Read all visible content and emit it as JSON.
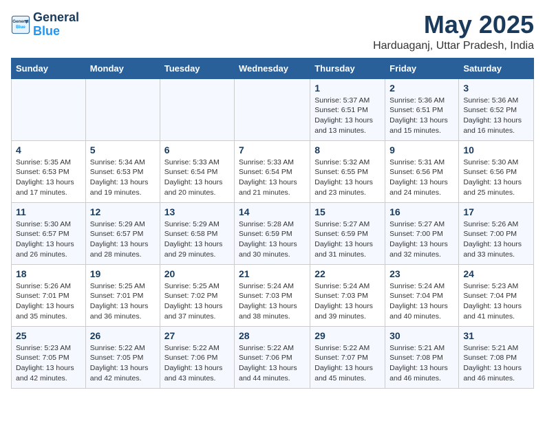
{
  "header": {
    "logo_line1": "General",
    "logo_line2": "Blue",
    "month_year": "May 2025",
    "location": "Harduaganj, Uttar Pradesh, India"
  },
  "days_of_week": [
    "Sunday",
    "Monday",
    "Tuesday",
    "Wednesday",
    "Thursday",
    "Friday",
    "Saturday"
  ],
  "weeks": [
    [
      {
        "day": "",
        "info": ""
      },
      {
        "day": "",
        "info": ""
      },
      {
        "day": "",
        "info": ""
      },
      {
        "day": "",
        "info": ""
      },
      {
        "day": "1",
        "info": "Sunrise: 5:37 AM\nSunset: 6:51 PM\nDaylight: 13 hours\nand 13 minutes."
      },
      {
        "day": "2",
        "info": "Sunrise: 5:36 AM\nSunset: 6:51 PM\nDaylight: 13 hours\nand 15 minutes."
      },
      {
        "day": "3",
        "info": "Sunrise: 5:36 AM\nSunset: 6:52 PM\nDaylight: 13 hours\nand 16 minutes."
      }
    ],
    [
      {
        "day": "4",
        "info": "Sunrise: 5:35 AM\nSunset: 6:53 PM\nDaylight: 13 hours\nand 17 minutes."
      },
      {
        "day": "5",
        "info": "Sunrise: 5:34 AM\nSunset: 6:53 PM\nDaylight: 13 hours\nand 19 minutes."
      },
      {
        "day": "6",
        "info": "Sunrise: 5:33 AM\nSunset: 6:54 PM\nDaylight: 13 hours\nand 20 minutes."
      },
      {
        "day": "7",
        "info": "Sunrise: 5:33 AM\nSunset: 6:54 PM\nDaylight: 13 hours\nand 21 minutes."
      },
      {
        "day": "8",
        "info": "Sunrise: 5:32 AM\nSunset: 6:55 PM\nDaylight: 13 hours\nand 23 minutes."
      },
      {
        "day": "9",
        "info": "Sunrise: 5:31 AM\nSunset: 6:56 PM\nDaylight: 13 hours\nand 24 minutes."
      },
      {
        "day": "10",
        "info": "Sunrise: 5:30 AM\nSunset: 6:56 PM\nDaylight: 13 hours\nand 25 minutes."
      }
    ],
    [
      {
        "day": "11",
        "info": "Sunrise: 5:30 AM\nSunset: 6:57 PM\nDaylight: 13 hours\nand 26 minutes."
      },
      {
        "day": "12",
        "info": "Sunrise: 5:29 AM\nSunset: 6:57 PM\nDaylight: 13 hours\nand 28 minutes."
      },
      {
        "day": "13",
        "info": "Sunrise: 5:29 AM\nSunset: 6:58 PM\nDaylight: 13 hours\nand 29 minutes."
      },
      {
        "day": "14",
        "info": "Sunrise: 5:28 AM\nSunset: 6:59 PM\nDaylight: 13 hours\nand 30 minutes."
      },
      {
        "day": "15",
        "info": "Sunrise: 5:27 AM\nSunset: 6:59 PM\nDaylight: 13 hours\nand 31 minutes."
      },
      {
        "day": "16",
        "info": "Sunrise: 5:27 AM\nSunset: 7:00 PM\nDaylight: 13 hours\nand 32 minutes."
      },
      {
        "day": "17",
        "info": "Sunrise: 5:26 AM\nSunset: 7:00 PM\nDaylight: 13 hours\nand 33 minutes."
      }
    ],
    [
      {
        "day": "18",
        "info": "Sunrise: 5:26 AM\nSunset: 7:01 PM\nDaylight: 13 hours\nand 35 minutes."
      },
      {
        "day": "19",
        "info": "Sunrise: 5:25 AM\nSunset: 7:01 PM\nDaylight: 13 hours\nand 36 minutes."
      },
      {
        "day": "20",
        "info": "Sunrise: 5:25 AM\nSunset: 7:02 PM\nDaylight: 13 hours\nand 37 minutes."
      },
      {
        "day": "21",
        "info": "Sunrise: 5:24 AM\nSunset: 7:03 PM\nDaylight: 13 hours\nand 38 minutes."
      },
      {
        "day": "22",
        "info": "Sunrise: 5:24 AM\nSunset: 7:03 PM\nDaylight: 13 hours\nand 39 minutes."
      },
      {
        "day": "23",
        "info": "Sunrise: 5:24 AM\nSunset: 7:04 PM\nDaylight: 13 hours\nand 40 minutes."
      },
      {
        "day": "24",
        "info": "Sunrise: 5:23 AM\nSunset: 7:04 PM\nDaylight: 13 hours\nand 41 minutes."
      }
    ],
    [
      {
        "day": "25",
        "info": "Sunrise: 5:23 AM\nSunset: 7:05 PM\nDaylight: 13 hours\nand 42 minutes."
      },
      {
        "day": "26",
        "info": "Sunrise: 5:22 AM\nSunset: 7:05 PM\nDaylight: 13 hours\nand 42 minutes."
      },
      {
        "day": "27",
        "info": "Sunrise: 5:22 AM\nSunset: 7:06 PM\nDaylight: 13 hours\nand 43 minutes."
      },
      {
        "day": "28",
        "info": "Sunrise: 5:22 AM\nSunset: 7:06 PM\nDaylight: 13 hours\nand 44 minutes."
      },
      {
        "day": "29",
        "info": "Sunrise: 5:22 AM\nSunset: 7:07 PM\nDaylight: 13 hours\nand 45 minutes."
      },
      {
        "day": "30",
        "info": "Sunrise: 5:21 AM\nSunset: 7:08 PM\nDaylight: 13 hours\nand 46 minutes."
      },
      {
        "day": "31",
        "info": "Sunrise: 5:21 AM\nSunset: 7:08 PM\nDaylight: 13 hours\nand 46 minutes."
      }
    ]
  ]
}
